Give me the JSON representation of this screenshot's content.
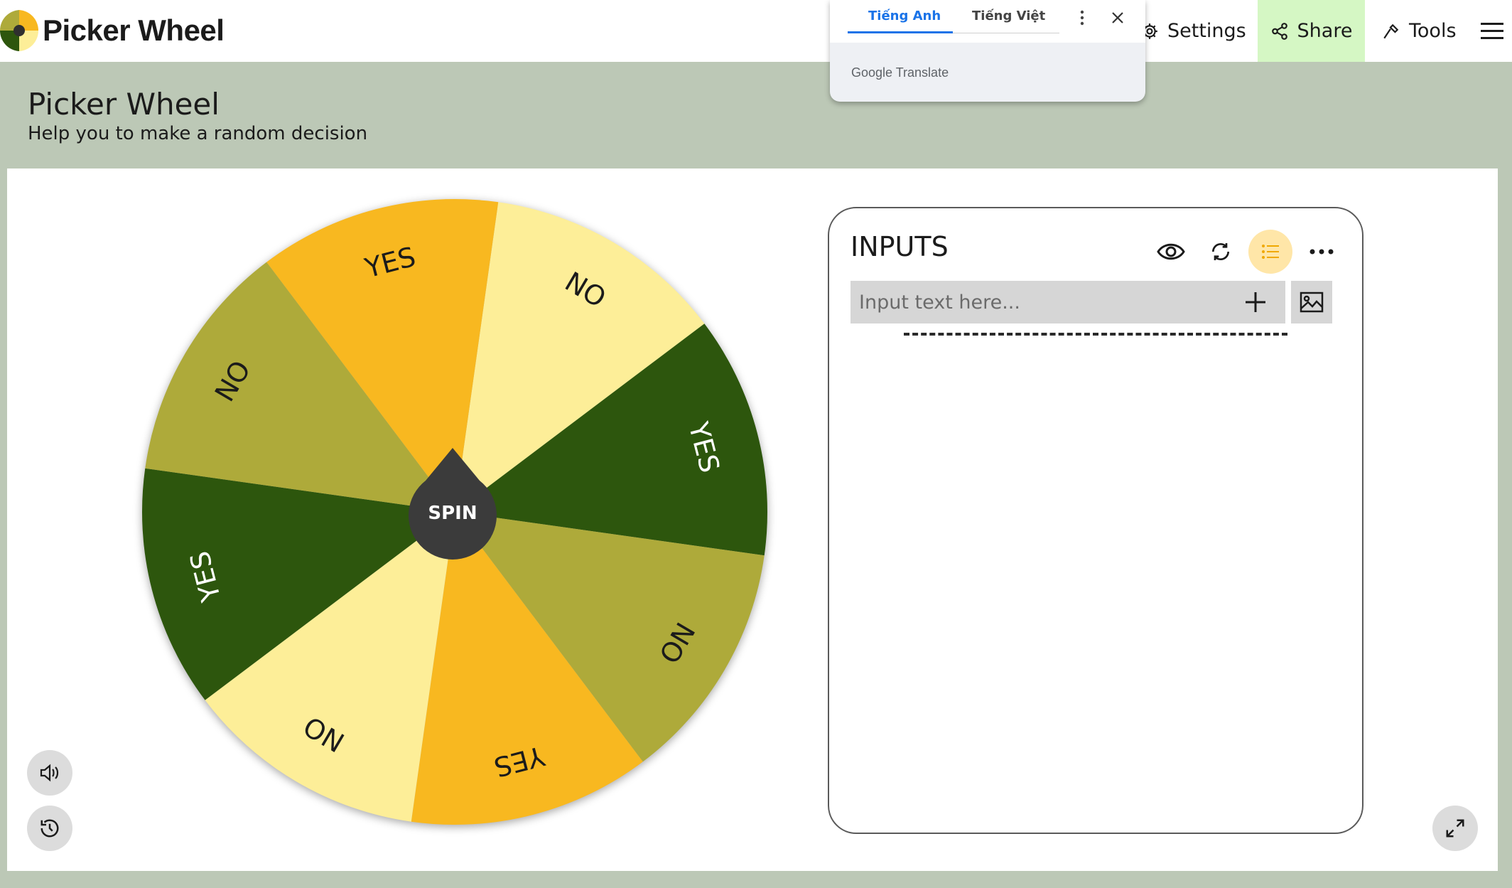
{
  "nav": {
    "brand": "Picker Wheel",
    "settings": "Settings",
    "share": "Share",
    "tools": "Tools"
  },
  "header": {
    "title": "Picker Wheel",
    "subtitle": "Help you to make a random decision"
  },
  "wheel": {
    "spin_label": "SPIN",
    "segments": [
      {
        "label": "NO",
        "color": "#fdee98"
      },
      {
        "label": "YES",
        "color": "#2d560d"
      },
      {
        "label": "NO",
        "color": "#aeaa3a"
      },
      {
        "label": "YES",
        "color": "#f8b820"
      },
      {
        "label": "NO",
        "color": "#fdee98"
      },
      {
        "label": "YES",
        "color": "#2d560d"
      },
      {
        "label": "NO",
        "color": "#aeaa3a"
      },
      {
        "label": "YES",
        "color": "#f8b820"
      }
    ]
  },
  "inputs": {
    "title": "INPUTS",
    "placeholder": "Input text here..."
  },
  "translate": {
    "tab_source": "Tiếng Anh",
    "tab_target": "Tiếng Việt",
    "brand": "Google Translate"
  },
  "colors": {
    "band": "#bcc8b6",
    "share_bg": "#d5f7c4",
    "accent": "#ffe6a8",
    "translate_blue": "#1a73e8"
  }
}
